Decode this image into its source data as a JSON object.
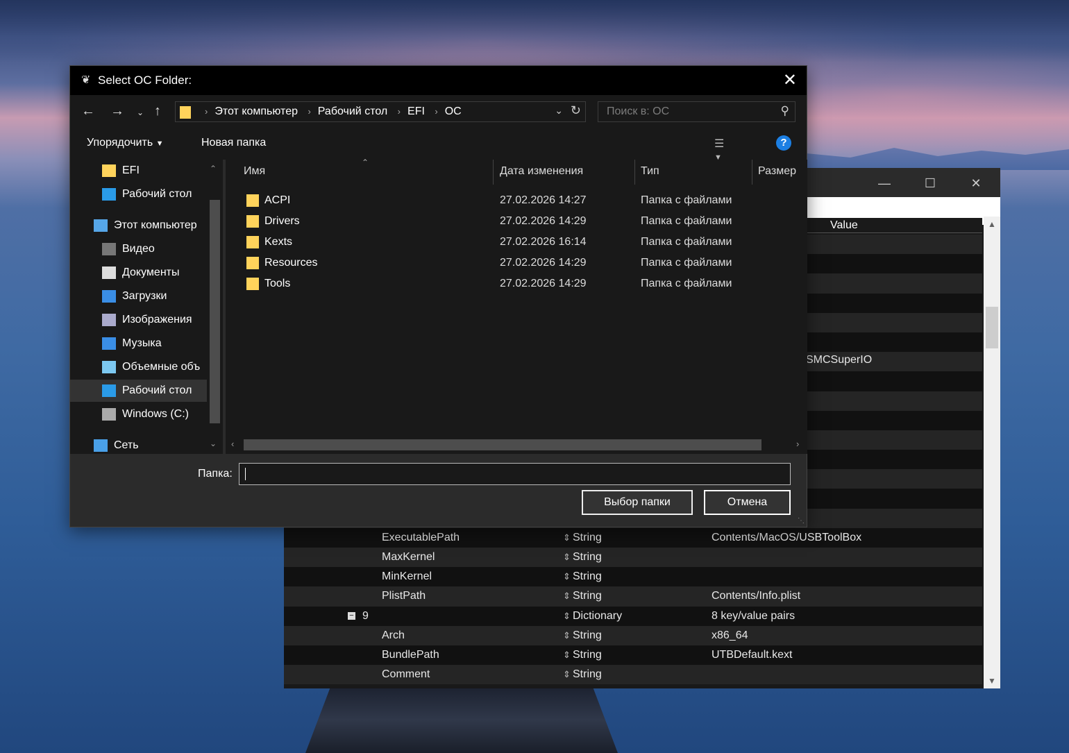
{
  "dialog": {
    "title": "Select OC Folder:",
    "breadcrumb": [
      "Этот компьютер",
      "Рабочий стол",
      "EFI",
      "OC"
    ],
    "search_placeholder": "Поиск в: OC",
    "toolbar": {
      "organize": "Упорядочить",
      "new_folder": "Новая папка"
    },
    "help_label": "?",
    "columns": {
      "name": "Имя",
      "date": "Дата изменения",
      "type": "Тип",
      "size": "Размер"
    },
    "nav_items": [
      {
        "label": "EFI",
        "icon": "folder-icon"
      },
      {
        "label": "Рабочий стол",
        "icon": "desktop-icon"
      },
      {
        "label": "Этот компьютер",
        "icon": "computer-icon"
      },
      {
        "label": "Видео",
        "icon": "video-icon"
      },
      {
        "label": "Документы",
        "icon": "document-icon"
      },
      {
        "label": "Загрузки",
        "icon": "download-icon"
      },
      {
        "label": "Изображения",
        "icon": "pictures-icon"
      },
      {
        "label": "Музыка",
        "icon": "music-icon"
      },
      {
        "label": "Объемные объ",
        "icon": "3d-objects-icon"
      },
      {
        "label": "Рабочий стол",
        "icon": "desktop-icon"
      },
      {
        "label": "Windows (C:)",
        "icon": "drive-icon"
      },
      {
        "label": "Сеть",
        "icon": "network-icon"
      }
    ],
    "files": [
      {
        "name": "ACPI",
        "date": "27.02.2026 14:27",
        "type": "Папка с файлами"
      },
      {
        "name": "Drivers",
        "date": "27.02.2026 14:29",
        "type": "Папка с файлами"
      },
      {
        "name": "Kexts",
        "date": "27.02.2026 16:14",
        "type": "Папка с файлами"
      },
      {
        "name": "Resources",
        "date": "27.02.2026 14:29",
        "type": "Папка с файлами"
      },
      {
        "name": "Tools",
        "date": "27.02.2026 14:29",
        "type": "Папка с файлами"
      }
    ],
    "folder_label": "Папка:",
    "folder_value": "",
    "select_button": "Выбор папки",
    "cancel_button": "Отмена"
  },
  "background_window": {
    "value_header": "Value",
    "peek_value": "SMCSuperIO",
    "rows": [
      {
        "key": "ExecutablePath",
        "type": "String",
        "value": "Contents/MacOS/USBToolBox"
      },
      {
        "key": "MaxKernel",
        "type": "String",
        "value": ""
      },
      {
        "key": "MinKernel",
        "type": "String",
        "value": ""
      },
      {
        "key": "PlistPath",
        "type": "String",
        "value": "Contents/Info.plist"
      },
      {
        "key": "9",
        "type": "Dictionary",
        "value": "8 key/value pairs",
        "collapsible": true
      },
      {
        "key": "Arch",
        "type": "String",
        "value": "x86_64"
      },
      {
        "key": "BundlePath",
        "type": "String",
        "value": "UTBDefault.kext"
      },
      {
        "key": "Comment",
        "type": "String",
        "value": ""
      }
    ]
  }
}
